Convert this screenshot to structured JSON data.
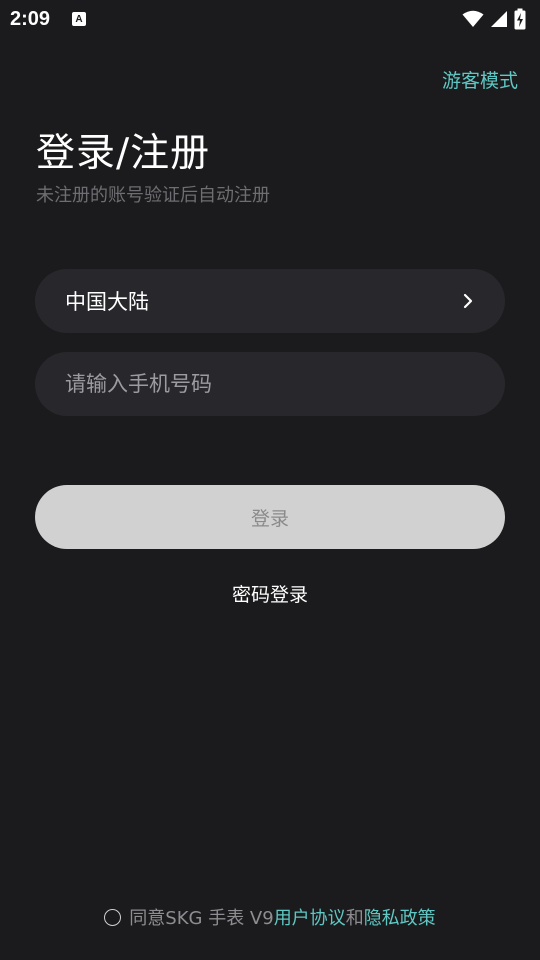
{
  "status_bar": {
    "time": "2:09",
    "notification_letter": "A"
  },
  "header": {
    "guest_mode": "游客模式"
  },
  "title": {
    "heading": "登录/注册",
    "subtitle": "未注册的账号验证后自动注册"
  },
  "form": {
    "region": "中国大陆",
    "phone_placeholder": "请输入手机号码",
    "phone_value": "",
    "login_button": "登录",
    "password_login": "密码登录"
  },
  "agreement": {
    "prefix": "同意SKG 手表 V9",
    "user_agreement": "用户协议",
    "and": "和",
    "privacy_policy": "隐私政策"
  },
  "colors": {
    "background": "#1b1b1d",
    "field_background": "#28282c",
    "accent": "#5fc8c4",
    "button_disabled": "#d0d1d0"
  }
}
